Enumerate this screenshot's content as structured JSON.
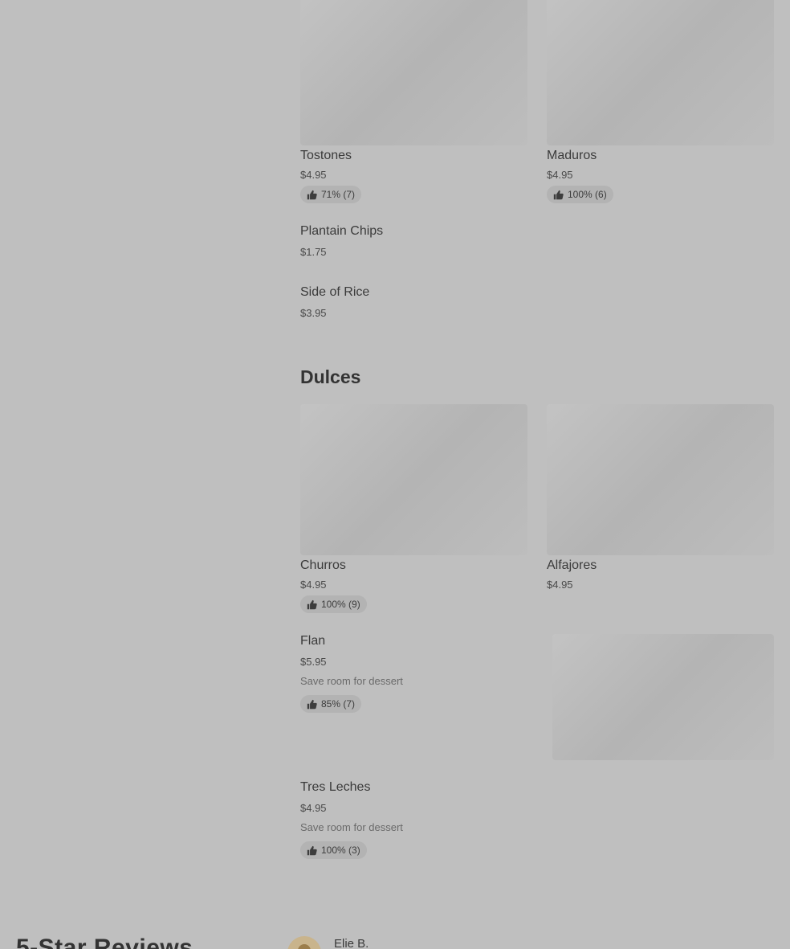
{
  "sides": {
    "items": [
      {
        "name": "Tostones",
        "price": "$4.95",
        "rating": "71% (7)"
      },
      {
        "name": "Maduros",
        "price": "$4.95",
        "rating": "100% (6)"
      },
      {
        "name": "Plantain Chips",
        "price": "$1.75"
      },
      {
        "name": "Side of Rice",
        "price": "$3.95"
      }
    ]
  },
  "dulces": {
    "title": "Dulces",
    "items": [
      {
        "name": "Churros",
        "price": "$4.95",
        "rating": "100% (9)"
      },
      {
        "name": "Alfajores",
        "price": "$4.95"
      },
      {
        "name": "Flan",
        "price": "$5.95",
        "description": "Save room for dessert",
        "rating": "85% (7)"
      },
      {
        "name": "Tres Leches",
        "price": "$4.95",
        "description": "Save room for dessert",
        "rating": "100% (3)"
      }
    ]
  },
  "reviews": {
    "title": "5-Star Reviews",
    "first_reviewer": "Elie B."
  }
}
